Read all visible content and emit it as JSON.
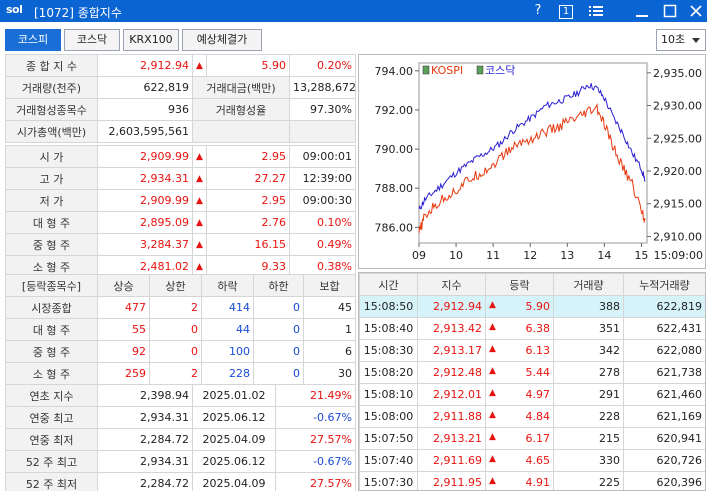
{
  "window": {
    "logo": "sol",
    "title": "[1072] 종합지수",
    "help": "?",
    "one": "1"
  },
  "tabs": [
    "코스피",
    "코스닥",
    "KRX100",
    "예상체결가"
  ],
  "interval": "10초",
  "summary": {
    "index_label": "종 합 지 수",
    "index": "2,912.94",
    "change": "5.90",
    "rate": "0.20%",
    "vol_label": "거래량(천주)",
    "vol": "622,819",
    "amt_label": "거래대금(백만)",
    "amt": "13,288,672",
    "stocks_label": "거래형성종목수",
    "stocks": "936",
    "ratio_label": "거래형성율",
    "ratio": "97.30%",
    "cap_label": "시가총액(백만)",
    "cap": "2,603,595,561"
  },
  "prices": [
    {
      "label": "시 가",
      "value": "2,909.99",
      "change": "2.95",
      "extra": "09:00:01"
    },
    {
      "label": "고 가",
      "value": "2,934.31",
      "change": "27.27",
      "extra": "12:39:00"
    },
    {
      "label": "저 가",
      "value": "2,909.99",
      "change": "2.95",
      "extra": "09:00:30"
    },
    {
      "label": "대 형 주",
      "value": "2,895.09",
      "change": "2.76",
      "extra": "0.10%"
    },
    {
      "label": "중 형 주",
      "value": "3,284.37",
      "change": "16.15",
      "extra": "0.49%"
    },
    {
      "label": "소 형 주",
      "value": "2,481.02",
      "change": "9.33",
      "extra": "0.38%"
    }
  ],
  "breadth": {
    "headers": [
      "[등락종목수]",
      "상승",
      "상한",
      "하락",
      "하한",
      "보합"
    ],
    "rows": [
      {
        "label": "시장종합",
        "up": "477",
        "upper": "2",
        "down": "414",
        "lower": "0",
        "flat": "45"
      },
      {
        "label": "대 형 주",
        "up": "55",
        "upper": "0",
        "down": "44",
        "lower": "0",
        "flat": "1"
      },
      {
        "label": "중 형 주",
        "up": "92",
        "upper": "0",
        "down": "100",
        "lower": "0",
        "flat": "6"
      },
      {
        "label": "소 형 주",
        "up": "259",
        "upper": "2",
        "down": "228",
        "lower": "0",
        "flat": "30"
      }
    ]
  },
  "yearly": [
    {
      "label": "연초 지수",
      "value": "2,398.94",
      "date": "2025.01.02",
      "rate": "21.49%"
    },
    {
      "label": "연중 최고",
      "value": "2,934.31",
      "date": "2025.06.12",
      "rate": "-0.67%"
    },
    {
      "label": "연중 최저",
      "value": "2,284.72",
      "date": "2025.04.09",
      "rate": "27.57%"
    },
    {
      "label": "52 주 최고",
      "value": "2,934.31",
      "date": "2025.06.12",
      "rate": "-0.67%"
    },
    {
      "label": "52 주 최저",
      "value": "2,284.72",
      "date": "2025.04.09",
      "rate": "27.57%"
    }
  ],
  "ticks": {
    "headers": [
      "시간",
      "지수",
      "등락",
      "거래량",
      "누적거래량"
    ],
    "rows": [
      {
        "time": "15:08:50",
        "index": "2,912.94",
        "change": "5.90",
        "vol": "388",
        "cum": "622,819"
      },
      {
        "time": "15:08:40",
        "index": "2,913.42",
        "change": "6.38",
        "vol": "351",
        "cum": "622,431"
      },
      {
        "time": "15:08:30",
        "index": "2,913.17",
        "change": "6.13",
        "vol": "342",
        "cum": "622,080"
      },
      {
        "time": "15:08:20",
        "index": "2,912.48",
        "change": "5.44",
        "vol": "278",
        "cum": "621,738"
      },
      {
        "time": "15:08:10",
        "index": "2,912.01",
        "change": "4.97",
        "vol": "291",
        "cum": "621,460"
      },
      {
        "time": "15:08:00",
        "index": "2,911.88",
        "change": "4.84",
        "vol": "228",
        "cum": "621,169"
      },
      {
        "time": "15:07:50",
        "index": "2,913.21",
        "change": "6.17",
        "vol": "215",
        "cum": "620,941"
      },
      {
        "time": "15:07:40",
        "index": "2,911.69",
        "change": "4.65",
        "vol": "330",
        "cum": "620,726"
      },
      {
        "time": "15:07:30",
        "index": "2,911.95",
        "change": "4.91",
        "vol": "225",
        "cum": "620,396"
      }
    ]
  },
  "chart_data": {
    "type": "line",
    "legend": [
      "KOSPI",
      "코스닥"
    ],
    "colors": {
      "KOSPI": "#e8390f",
      "코스닥": "#2a1fd0"
    },
    "x_ticks": [
      "09",
      "10",
      "11",
      "12",
      "13",
      "14",
      "15"
    ],
    "end_time": "15:09:00",
    "left_axis": {
      "ticks": [
        "794.00",
        "792.00",
        "790.00",
        "788.00",
        "786.00"
      ],
      "range": [
        785.2,
        794.4
      ]
    },
    "right_axis": {
      "ticks": [
        "2,935.00",
        "2,930.00",
        "2,925.00",
        "2,920.00",
        "2,915.00",
        "2,910.00"
      ],
      "range": [
        2909,
        2936.5
      ]
    },
    "series": [
      {
        "name": "코스닥",
        "axis": "left",
        "x": [
          9.0,
          9.15,
          9.4,
          9.7,
          10.0,
          10.3,
          10.6,
          10.9,
          11.2,
          11.5,
          11.8,
          12.1,
          12.4,
          12.7,
          13.0,
          13.3,
          13.55,
          13.8,
          14.0,
          14.25,
          14.5,
          14.75,
          15.0,
          15.1
        ],
        "values": [
          786.9,
          787.4,
          787.8,
          788.3,
          788.8,
          789.2,
          789.6,
          789.9,
          790.3,
          790.9,
          791.3,
          791.7,
          792.2,
          792.4,
          792.6,
          792.9,
          793.3,
          793.1,
          792.6,
          791.6,
          790.8,
          789.8,
          789.0,
          788.4
        ]
      },
      {
        "name": "KOSPI",
        "axis": "right",
        "x": [
          9.0,
          9.15,
          9.4,
          9.7,
          10.0,
          10.3,
          10.6,
          10.9,
          11.2,
          11.5,
          11.8,
          12.1,
          12.4,
          12.7,
          13.0,
          13.3,
          13.55,
          13.8,
          14.0,
          14.25,
          14.5,
          14.75,
          15.0,
          15.1
        ],
        "values": [
          2910.5,
          2913.0,
          2914.5,
          2916.0,
          2917.0,
          2918.5,
          2919.5,
          2920.5,
          2922.0,
          2923.5,
          2924.5,
          2925.0,
          2926.0,
          2926.5,
          2927.5,
          2928.0,
          2929.0,
          2929.5,
          2927.0,
          2923.5,
          2920.5,
          2918.0,
          2914.0,
          2912.5
        ]
      }
    ]
  }
}
